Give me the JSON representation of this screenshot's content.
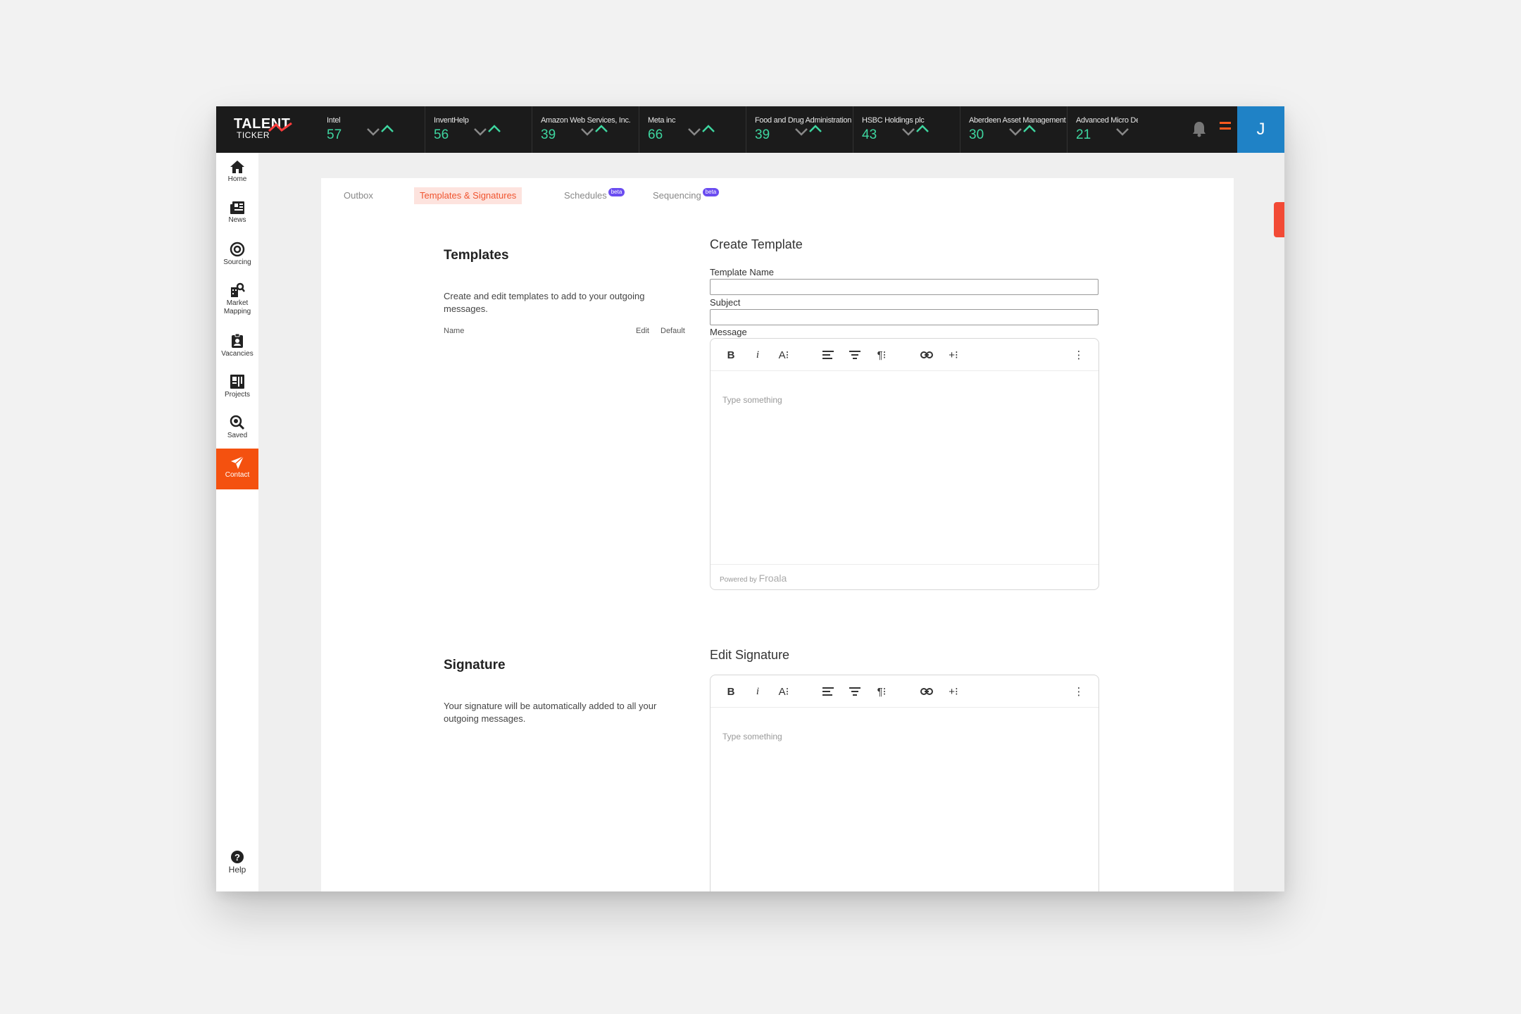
{
  "logo": {
    "line1": "TALENT",
    "line2": "TICKER"
  },
  "ticker": [
    {
      "name": "Intel",
      "value": "57"
    },
    {
      "name": "InventHelp",
      "value": "56"
    },
    {
      "name": "Amazon Web Services, Inc.",
      "value": "39"
    },
    {
      "name": "Meta inc",
      "value": "66"
    },
    {
      "name": "Food and Drug Administration",
      "value": "39"
    },
    {
      "name": "HSBC Holdings plc",
      "value": "43"
    },
    {
      "name": "Aberdeen Asset Management",
      "value": "30"
    },
    {
      "name": "Advanced Micro Devices",
      "value": "21"
    }
  ],
  "user": {
    "initial": "J"
  },
  "sidebar": {
    "items": [
      {
        "label": "Home"
      },
      {
        "label": "News"
      },
      {
        "label": "Sourcing"
      },
      {
        "label": "Market Mapping"
      },
      {
        "label": "Vacancies"
      },
      {
        "label": "Projects"
      },
      {
        "label": "Saved"
      },
      {
        "label": "Contact"
      }
    ],
    "help": "Help"
  },
  "tabs": {
    "outbox": "Outbox",
    "templates": "Templates & Signatures",
    "schedules": "Schedules",
    "sequencing": "Sequencing",
    "beta": "beta"
  },
  "templates": {
    "title": "Templates",
    "description": "Create and edit templates to add to your outgoing messages.",
    "col_name": "Name",
    "col_edit": "Edit",
    "col_default": "Default"
  },
  "create_template": {
    "title": "Create Template",
    "name_label": "Template Name",
    "name_value": "",
    "subject_label": "Subject",
    "subject_value": "",
    "message_label": "Message",
    "placeholder": "Type something",
    "powered_by": "Powered by",
    "froala": "Froala"
  },
  "signature": {
    "title": "Signature",
    "description": "Your signature will be automatically added to all your outgoing messages.",
    "edit_title": "Edit Signature",
    "placeholder": "Type something"
  },
  "toolbar": {
    "bold": "B",
    "italic": "i",
    "font_size": "A⁝",
    "paragraph": "¶⁝",
    "insert": "+⁝",
    "more": "⋮"
  },
  "colors": {
    "accent": "#f4510f",
    "ticker_value": "#3ed6a0",
    "avatar": "#1f82c6",
    "beta": "#6a4cf0"
  }
}
